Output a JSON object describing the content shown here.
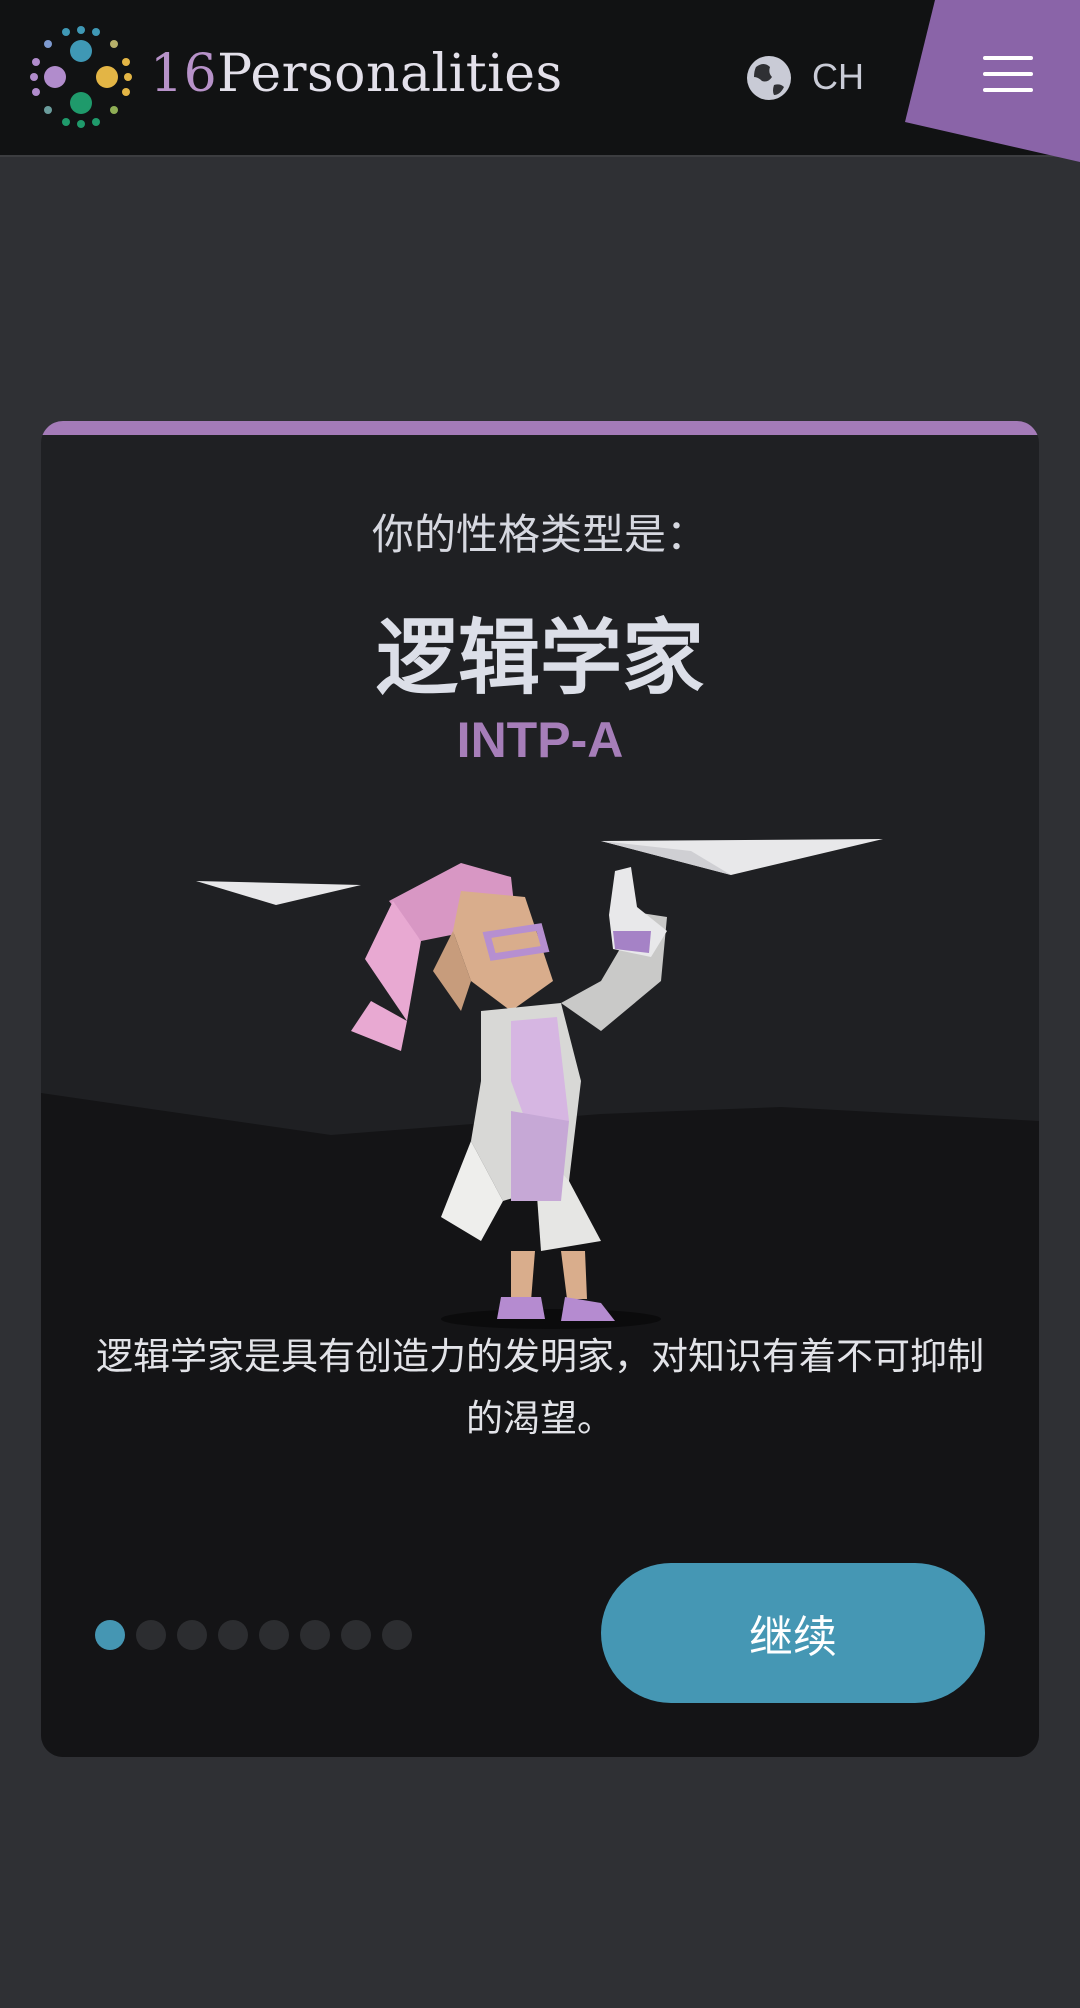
{
  "header": {
    "brand_number": "16",
    "brand_name": "Personalities",
    "language_code": "CH",
    "icons": {
      "logo": "16personalities-logo",
      "globe": "globe-icon",
      "menu": "hamburger-menu-icon"
    },
    "colors": {
      "bar": "#111213",
      "accent": "#8a64a8"
    }
  },
  "card": {
    "subtitle": "你的性格类型是：",
    "type_name": "逻辑学家",
    "type_code": "INTP-A",
    "illustration": "logician-scientist-illustration",
    "description": "逻辑学家是具有创造力的发明家，对知识有着不可抑制的渴望。",
    "progress": {
      "current_step": 1,
      "total_steps": 8
    },
    "continue_label": "继续",
    "colors": {
      "accent": "#a47bb8",
      "button": "#4597b4",
      "active_dot": "#4596b3"
    }
  }
}
